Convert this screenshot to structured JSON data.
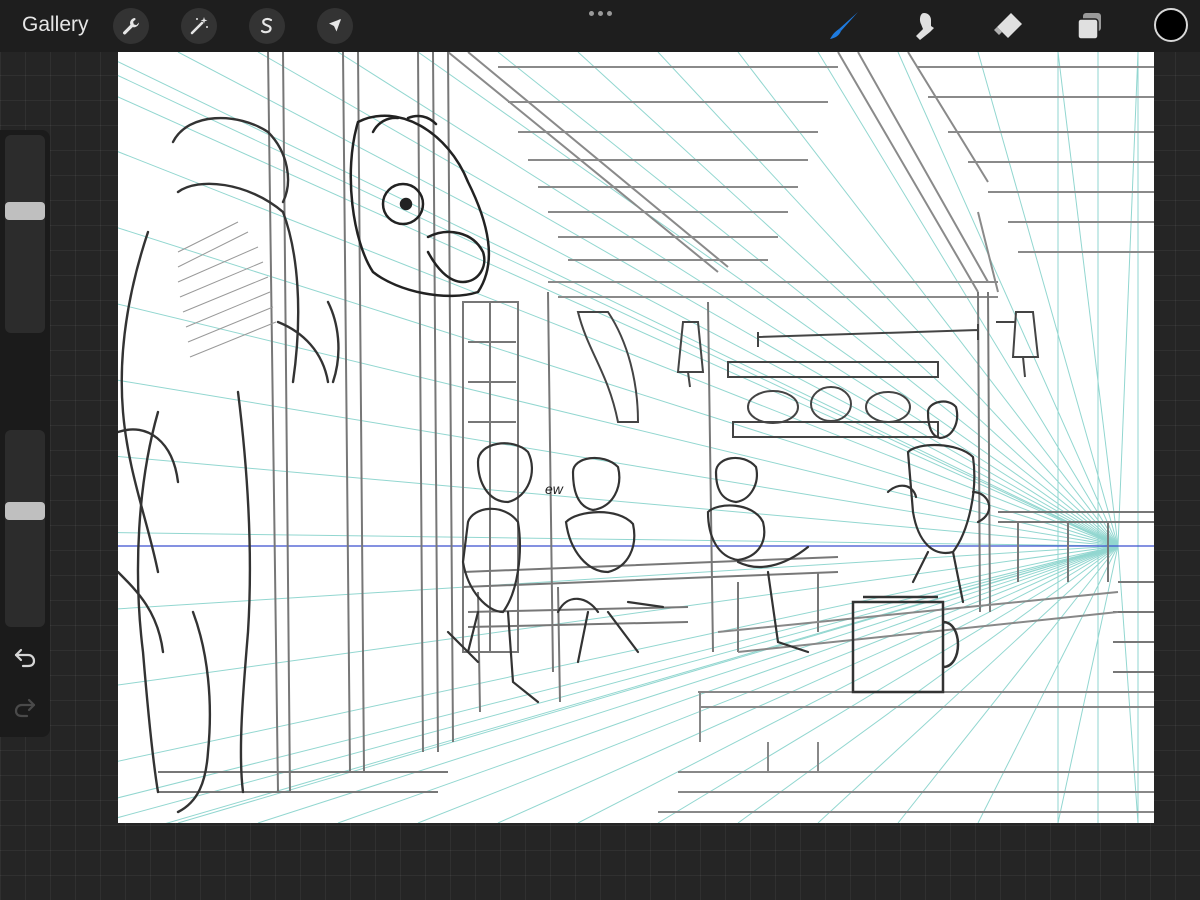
{
  "app": {
    "gallery_label": "Gallery"
  },
  "top_tools": {
    "left": [
      "wrench-icon",
      "magic-wand-icon",
      "selection-s-icon",
      "transform-arrow-icon"
    ],
    "right": [
      "brush-icon",
      "smudge-icon",
      "eraser-icon",
      "layers-icon"
    ]
  },
  "colors": {
    "brush_active": "#1e7be0",
    "current_color": "#000000",
    "perspective_guides": "#7fd0c8",
    "horizon_line": "#3b4fcf",
    "sketch_lines": "#333333"
  },
  "sidebar": {
    "brush_size_level": 0.63,
    "opacity_level": 0.6,
    "icons": [
      "modifier-square-icon",
      "undo-icon",
      "redo-icon"
    ]
  },
  "canvas": {
    "art": "sketch-tavern-scene-icon"
  }
}
